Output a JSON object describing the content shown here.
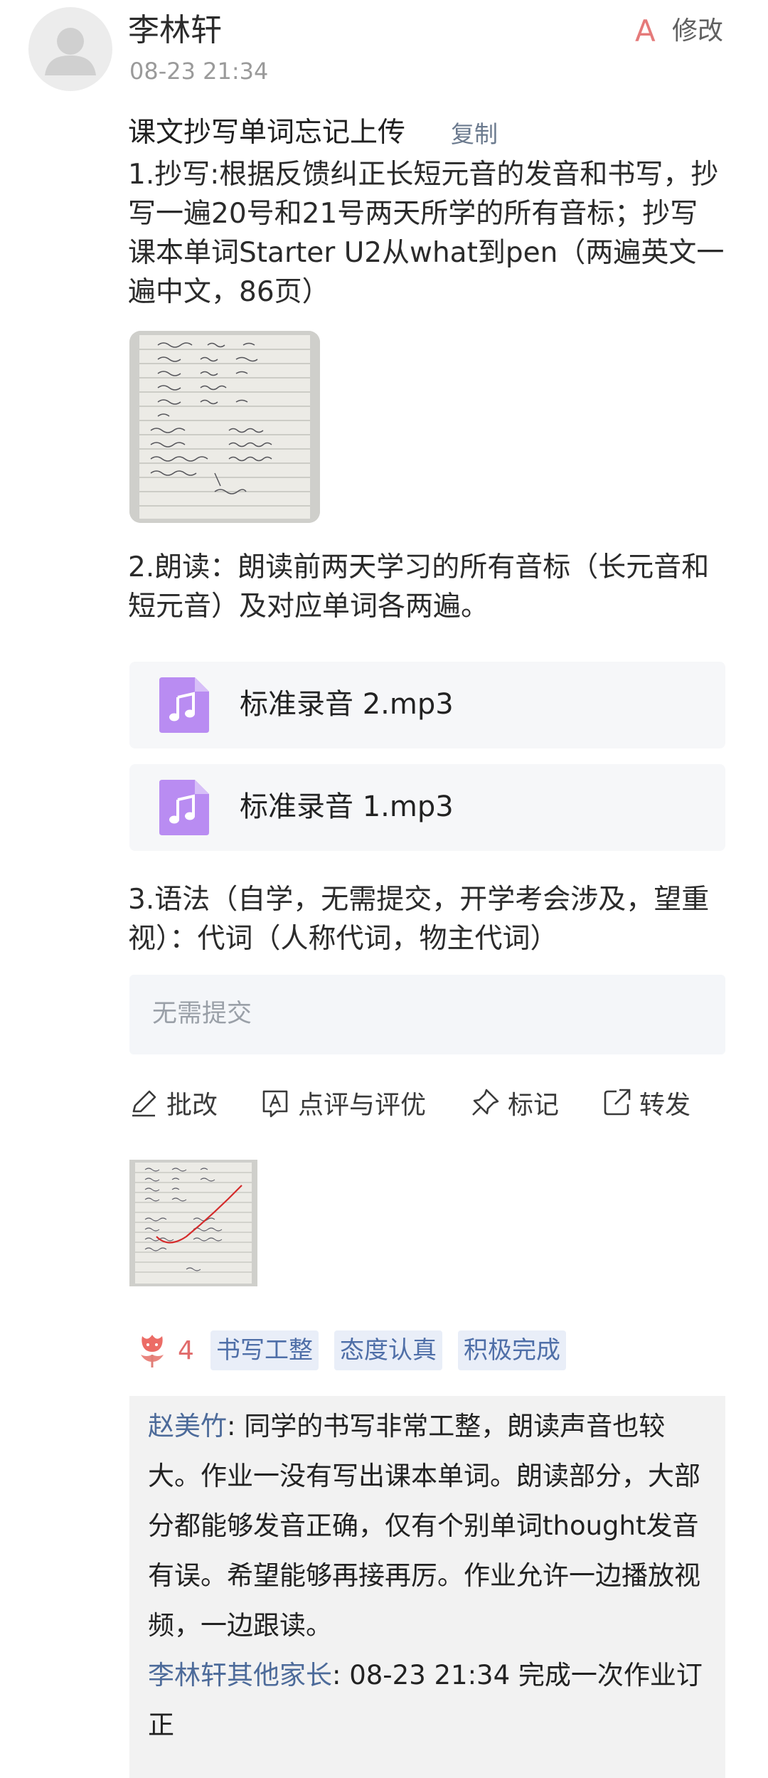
{
  "header": {
    "name": "李林轩",
    "time": "08-23 21:34",
    "grade": "A",
    "modify_label": "修改"
  },
  "task": {
    "title": "课文抄写单词忘记上传",
    "copy_label": "复制",
    "item1": "1.抄写:根据反馈纠正长短元音的发音和书写，抄写一遍20号和21号两天所学的所有音标；抄写课本单词Starter U2从what到pen（两遍英文一遍中文，86页）",
    "item2": "2.朗读：朗读前两天学习的所有音标（长元音和短元音）及对应单词各两遍。",
    "audio": [
      {
        "name": "标准录音 2.mp3",
        "icon": "music-note-icon"
      },
      {
        "name": "标准录音 1.mp3",
        "icon": "music-note-icon"
      }
    ],
    "item3": "3.语法（自学，无需提交，开学考会涉及，望重视）：代词（人称代词，物主代词）",
    "note": "无需提交"
  },
  "actions": [
    {
      "label": "批改",
      "icon": "pen-icon"
    },
    {
      "label": "点评与评优",
      "icon": "review-a-icon"
    },
    {
      "label": "标记",
      "icon": "pin-icon"
    },
    {
      "label": "转发",
      "icon": "share-icon"
    }
  ],
  "feedback": {
    "like_count": "4",
    "tags": [
      "书写工整",
      "态度认真",
      "积极完成"
    ],
    "comments": [
      {
        "author": "赵美竹",
        "text": ": 同学的书写非常工整，朗读声音也较大。作业一没有写出课本单词。朗读部分，大部分都能够发音正确，仅有个别单词thought发音有误。希望能够再接再厉。作业允许一边播放视频，一边跟读。"
      },
      {
        "author": "李林轩其他家长",
        "text": ": 08-23 21:34 完成一次作业订正"
      }
    ]
  },
  "colors": {
    "grade": "#e57a7a",
    "audio_icon": "#b98cf2",
    "tag_bg": "#e9eef8",
    "tag_text": "#4f6fa8",
    "comment_author": "#4d6b9a"
  }
}
